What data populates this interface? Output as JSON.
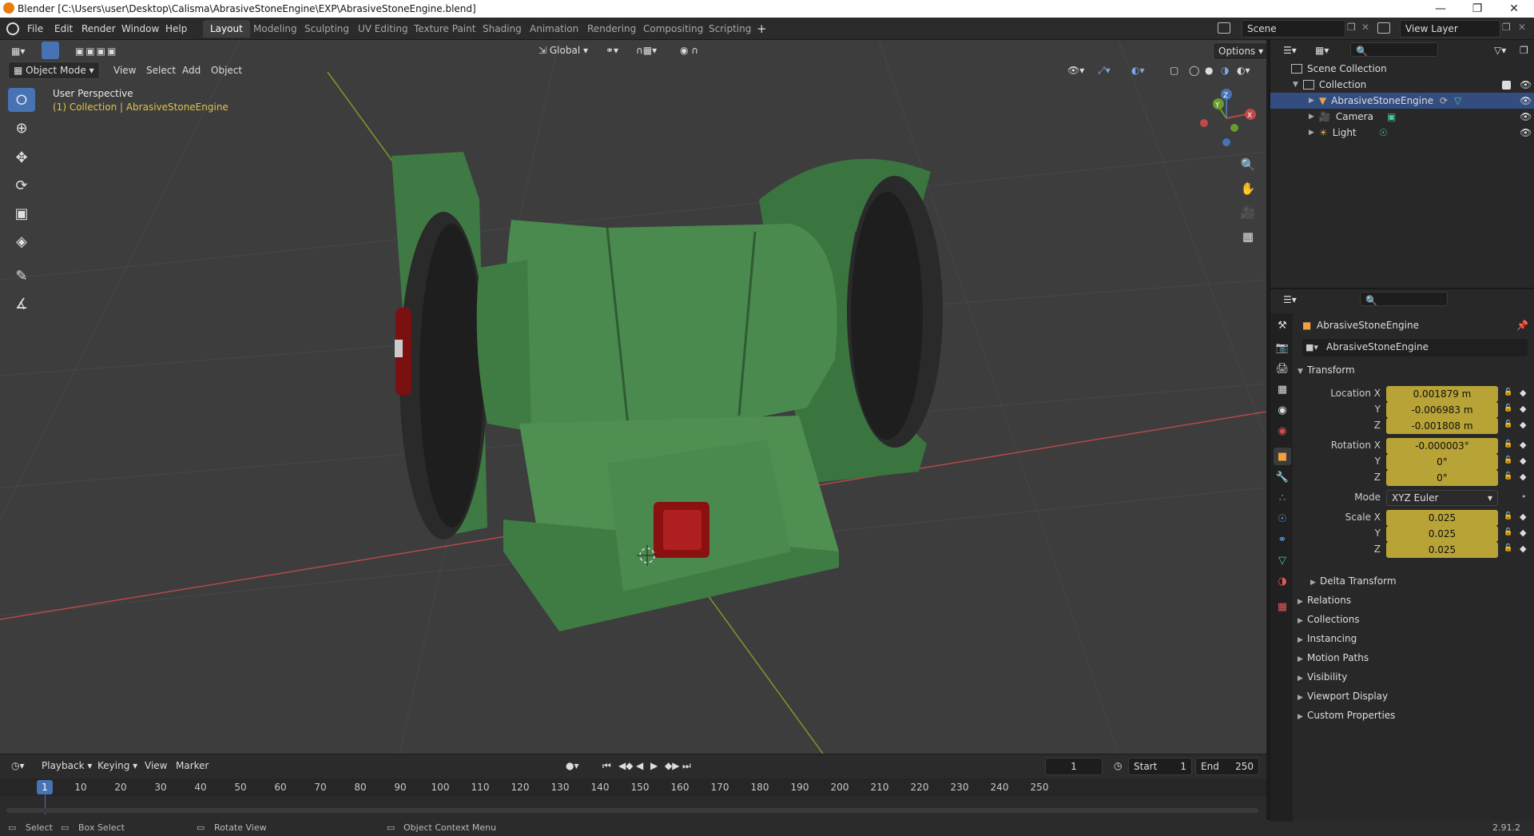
{
  "window": {
    "title": "Blender [C:\\Users\\user\\Desktop\\Calisma\\AbrasiveStoneEngine\\EXP\\AbrasiveStoneEngine.blend]"
  },
  "menu": [
    "File",
    "Edit",
    "Render",
    "Window",
    "Help"
  ],
  "workspaces": [
    "Layout",
    "Modeling",
    "Sculpting",
    "UV Editing",
    "Texture Paint",
    "Shading",
    "Animation",
    "Rendering",
    "Compositing",
    "Scripting"
  ],
  "scene": {
    "name": "Scene",
    "view_layer": "View Layer"
  },
  "viewport": {
    "mode": "Object Mode",
    "menus": [
      "View",
      "Select",
      "Add",
      "Object"
    ],
    "transform_orientation": "Global",
    "options_label": "Options",
    "perspective": "User Perspective",
    "collection_info": "(1) Collection | AbrasiveStoneEngine",
    "gizmo": {
      "z": "Z",
      "y": "Y",
      "x": "X"
    }
  },
  "outliner": {
    "root": "Scene Collection",
    "collection": "Collection",
    "items": [
      {
        "name": "AbrasiveStoneEngine"
      },
      {
        "name": "Camera"
      },
      {
        "name": "Light"
      }
    ]
  },
  "properties": {
    "object_name": "AbrasiveStoneEngine",
    "data_name": "AbrasiveStoneEngine",
    "transform_label": "Transform",
    "location": {
      "label": "Location X",
      "x": "0.001879 m",
      "y": "-0.006983 m",
      "z": "-0.001808 m"
    },
    "rotation": {
      "label": "Rotation X",
      "x": "-0.000003°",
      "y": "0°",
      "z": "0°"
    },
    "mode": {
      "label": "Mode",
      "value": "XYZ Euler"
    },
    "scale": {
      "label": "Scale X",
      "x": "0.025",
      "y": "0.025",
      "z": "0.025"
    },
    "axis_y": "Y",
    "axis_z": "Z",
    "delta_transform": "Delta Transform",
    "sections": [
      "Relations",
      "Collections",
      "Instancing",
      "Motion Paths",
      "Visibility",
      "Viewport Display",
      "Custom Properties"
    ]
  },
  "timeline": {
    "menus": [
      "Playback",
      "Keying",
      "View",
      "Marker"
    ],
    "current_frame": "1",
    "start_label": "Start",
    "start": "1",
    "end_label": "End",
    "end": "250",
    "ticks": [
      "1",
      "10",
      "20",
      "30",
      "40",
      "50",
      "60",
      "70",
      "80",
      "90",
      "100",
      "110",
      "120",
      "130",
      "140",
      "150",
      "160",
      "170",
      "180",
      "190",
      "200",
      "210",
      "220",
      "230",
      "240",
      "250"
    ]
  },
  "status": {
    "select": "Select",
    "box_select": "Box Select",
    "rotate_view": "Rotate View",
    "context_menu": "Object Context Menu",
    "version": "2.91.2"
  },
  "colors": {
    "accent": "#4772b3",
    "value_field": "#b7a336",
    "model_green": "#4a8a4e",
    "switch_red": "#8b1111"
  }
}
